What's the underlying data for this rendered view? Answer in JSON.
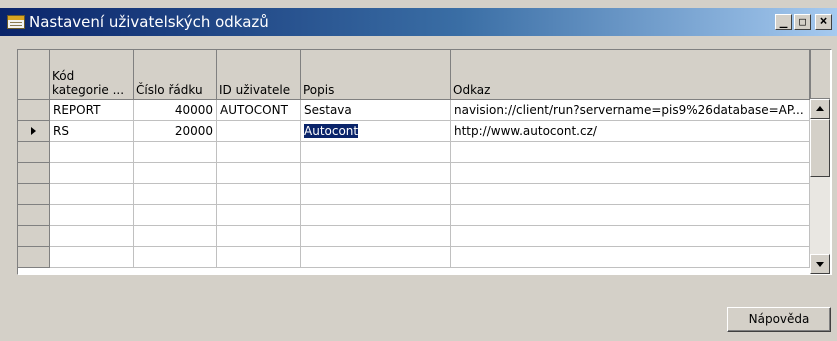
{
  "window": {
    "title": "Nastavení uživatelských odkazů",
    "icon": "table-icon",
    "controls": {
      "minimize": "_",
      "maximize": "□",
      "close": "×"
    }
  },
  "table": {
    "columns": [
      "Kód\nkategorie ...",
      "Číslo řádku",
      "ID uživatele",
      "Popis",
      "Odkaz"
    ],
    "rows": [
      {
        "kod": "REPORT",
        "cislo": "40000",
        "id": "AUTOCONT",
        "popis": "Sestava",
        "odkaz": "navision://client/run?servername=pis9%26database=AP..."
      },
      {
        "kod": "RS",
        "cislo": "20000",
        "id": "",
        "popis": "Autocont",
        "odkaz": "http://www.autocont.cz/"
      }
    ],
    "current_row_index": 1,
    "selected_cell": "Popis"
  },
  "buttons": {
    "help": "Nápověda"
  },
  "colors": {
    "selection": "#0a246a",
    "titlebar_start": "#0a246a",
    "titlebar_end": "#a6caf0"
  }
}
